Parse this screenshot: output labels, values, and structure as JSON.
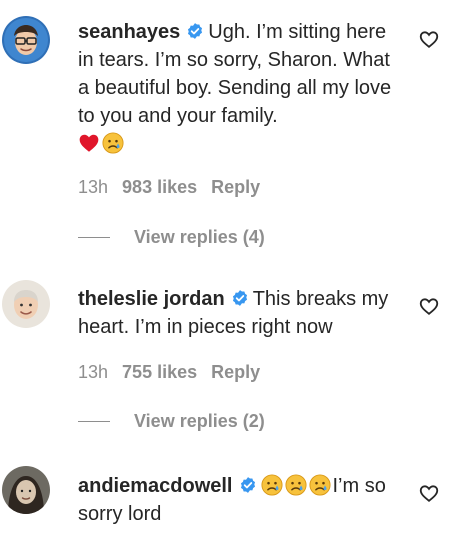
{
  "comments": [
    {
      "username": "seanhayes",
      "text": "Ugh. I’m sitting here in tears. I’m so sorry, Sharon. What a beautiful boy. Sending all my love to you and your family.",
      "time": "13h",
      "likes": "983 likes",
      "reply": "Reply",
      "view_replies": "View replies (4)"
    },
    {
      "username": "theleslie jordan",
      "text": "This breaks my heart. I’m in pieces right now",
      "time": "13h",
      "likes": "755 likes",
      "reply": "Reply",
      "view_replies": "View replies (2)"
    },
    {
      "username": "andiemacdowell",
      "text": "I’m so sorry lord"
    }
  ],
  "colors": {
    "verified": "#3897f0",
    "muted": "#8e8e8e",
    "text": "#262626"
  },
  "icons": [
    "verified-badge-icon",
    "red-heart-emoji",
    "sad-tear-emoji",
    "heart-outline-icon"
  ]
}
